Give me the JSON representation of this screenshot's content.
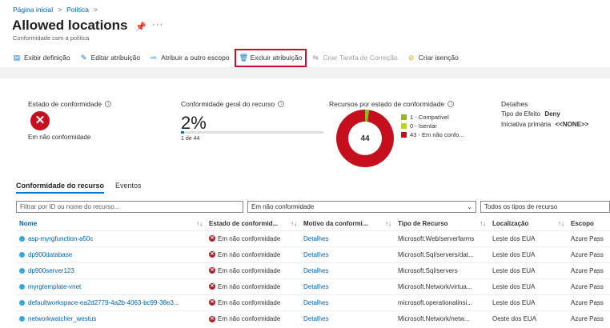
{
  "breadcrumb": {
    "home": "Página inicial",
    "separator": ">",
    "policy": "Política",
    "separator2": ">"
  },
  "header": {
    "title": "Allowed locations",
    "subtitle": "Conformidade com a política",
    "more": "···"
  },
  "toolbar": {
    "view_definition": "Exibir definição",
    "edit_assignment": "Editar atribuição",
    "assign_other_scope": "Atribuir a outro escopo",
    "delete_assignment": "Excluir atribuição",
    "create_remediation": "Criar Tarefa de Correção",
    "create_exemption": "Criar isenção"
  },
  "summary": {
    "compliance_state_title": "Estado de conformidade",
    "compliance_state_value": "Em não conformidade",
    "overall_title": "Conformidade geral do recurso",
    "overall_pct": "2%",
    "overall_count": "1 de 44",
    "overall_fraction": 0.02,
    "by_state_title": "Recursos por estado de conformidade",
    "donut_total": "44",
    "legend": [
      {
        "label": "1 - Compatível",
        "color": "#8cbd18",
        "value": 1
      },
      {
        "label": "0 - Isentar",
        "color": "#bad80a",
        "value": 0
      },
      {
        "label": "43 - Em não confo...",
        "color": "#c50f1f",
        "value": 43
      }
    ],
    "details_title": "Detalhes",
    "effect_label": "Tipo de Efeito",
    "effect_value": "Deny",
    "initiative_label": "Iniciativa primária",
    "initiative_value": "<<NONE>>"
  },
  "tabs": {
    "resource_compliance": "Conformidade do recurso",
    "events": "Eventos"
  },
  "filters": {
    "search_placeholder": "Filtrar por ID ou nome do recurso...",
    "compliance_filter": "Em não conformidade",
    "type_filter": "Todos os tipos de recurso"
  },
  "table": {
    "headers": [
      "Nome",
      "Estado de conformid...",
      "Motivo da conformi...",
      "Tipo de Recurso",
      "Localização",
      "Escopo"
    ],
    "sort_glyph": "↑↓",
    "rows": [
      [
        "asp-myrgfunction-a50c",
        "Em não conformidade",
        "Detalhes",
        "Microsoft.Web/serverfarms",
        "Leste dos EUA",
        "Azure Pass"
      ],
      [
        "dp900database",
        "Em não conformidade",
        "Detalhes",
        "Microsoft.Sql/servers/dat...",
        "Leste dos EUA",
        "Azure Pass"
      ],
      [
        "dp900server123",
        "Em não conformidade",
        "Detalhes",
        "Microsoft.Sql/servers",
        "Leste dos EUA",
        "Azure Pass"
      ],
      [
        "myrgtemplate-vnet",
        "Em não conformidade",
        "Detalhes",
        "Microsoft.Network/virtua...",
        "Leste dos EUA",
        "Azure Pass"
      ],
      [
        "defaultworkspace-ea2d2779-4a2b-4063-bc99-38e3...",
        "Em não conformidade",
        "Detalhes",
        "microsoft.operationalinsi...",
        "Leste dos EUA",
        "Azure Pass"
      ],
      [
        "networkwatcher_westus",
        "Em não conformidade",
        "Detalhes",
        "Microsoft.Network/netw...",
        "Oeste dos EUA",
        "Azure Pass"
      ]
    ]
  }
}
